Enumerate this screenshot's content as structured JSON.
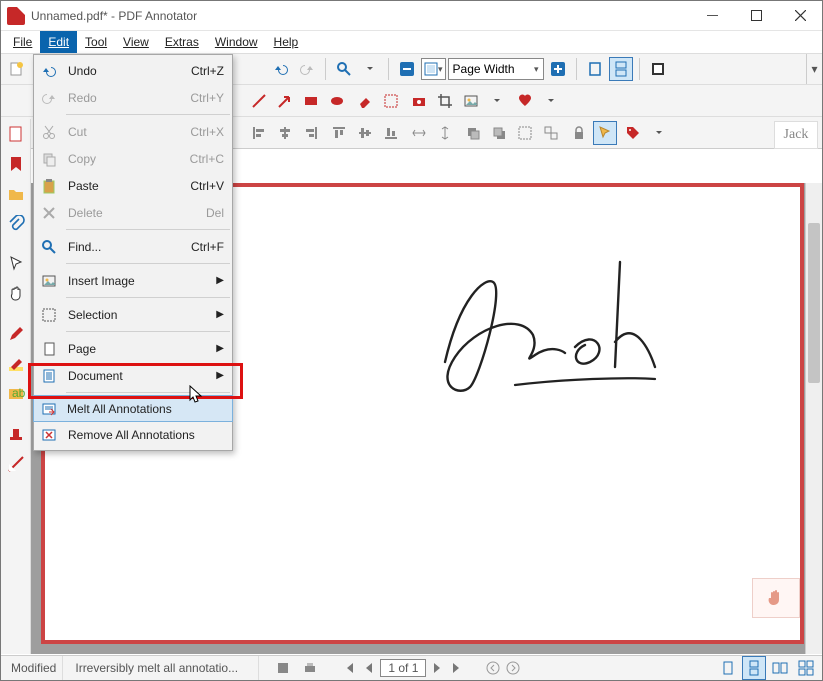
{
  "window": {
    "title": "Unnamed.pdf* - PDF Annotator"
  },
  "menubar": {
    "items": [
      {
        "label": "File"
      },
      {
        "label": "Edit"
      },
      {
        "label": "Tool"
      },
      {
        "label": "View"
      },
      {
        "label": "Extras"
      },
      {
        "label": "Window"
      },
      {
        "label": "Help"
      }
    ],
    "active_index": 1
  },
  "dropdown": {
    "items": [
      {
        "label": "Undo",
        "shortcut": "Ctrl+Z",
        "disabled": false,
        "icon": "undo"
      },
      {
        "label": "Redo",
        "shortcut": "Ctrl+Y",
        "disabled": true,
        "icon": "redo"
      },
      {
        "sep": true
      },
      {
        "label": "Cut",
        "shortcut": "Ctrl+X",
        "disabled": true,
        "icon": "cut"
      },
      {
        "label": "Copy",
        "shortcut": "Ctrl+C",
        "disabled": true,
        "icon": "copy"
      },
      {
        "label": "Paste",
        "shortcut": "Ctrl+V",
        "disabled": false,
        "icon": "paste"
      },
      {
        "label": "Delete",
        "shortcut": "Del",
        "disabled": true,
        "icon": "delete"
      },
      {
        "sep": true
      },
      {
        "label": "Find...",
        "shortcut": "Ctrl+F",
        "disabled": false,
        "icon": "find"
      },
      {
        "sep": true
      },
      {
        "label": "Insert Image",
        "submenu": true,
        "icon": "image"
      },
      {
        "sep": true
      },
      {
        "label": "Selection",
        "submenu": true,
        "icon": "selection"
      },
      {
        "sep": true
      },
      {
        "label": "Page",
        "submenu": true,
        "icon": "page"
      },
      {
        "label": "Document",
        "submenu": true,
        "icon": "document"
      },
      {
        "sep": true
      },
      {
        "label": "Melt All Annotations",
        "highlighted": true,
        "icon": "melt"
      },
      {
        "label": "Remove All Annotations",
        "icon": "remove"
      }
    ]
  },
  "toolbar1": {
    "zoom_mode": "Page Width",
    "zoom_icon_mode": "fit-page"
  },
  "statusbar": {
    "status": "Modified",
    "hint": "Irreversibly melt all annotatio...",
    "page_field": "1 of 1"
  },
  "signature_thumb": "Jack"
}
